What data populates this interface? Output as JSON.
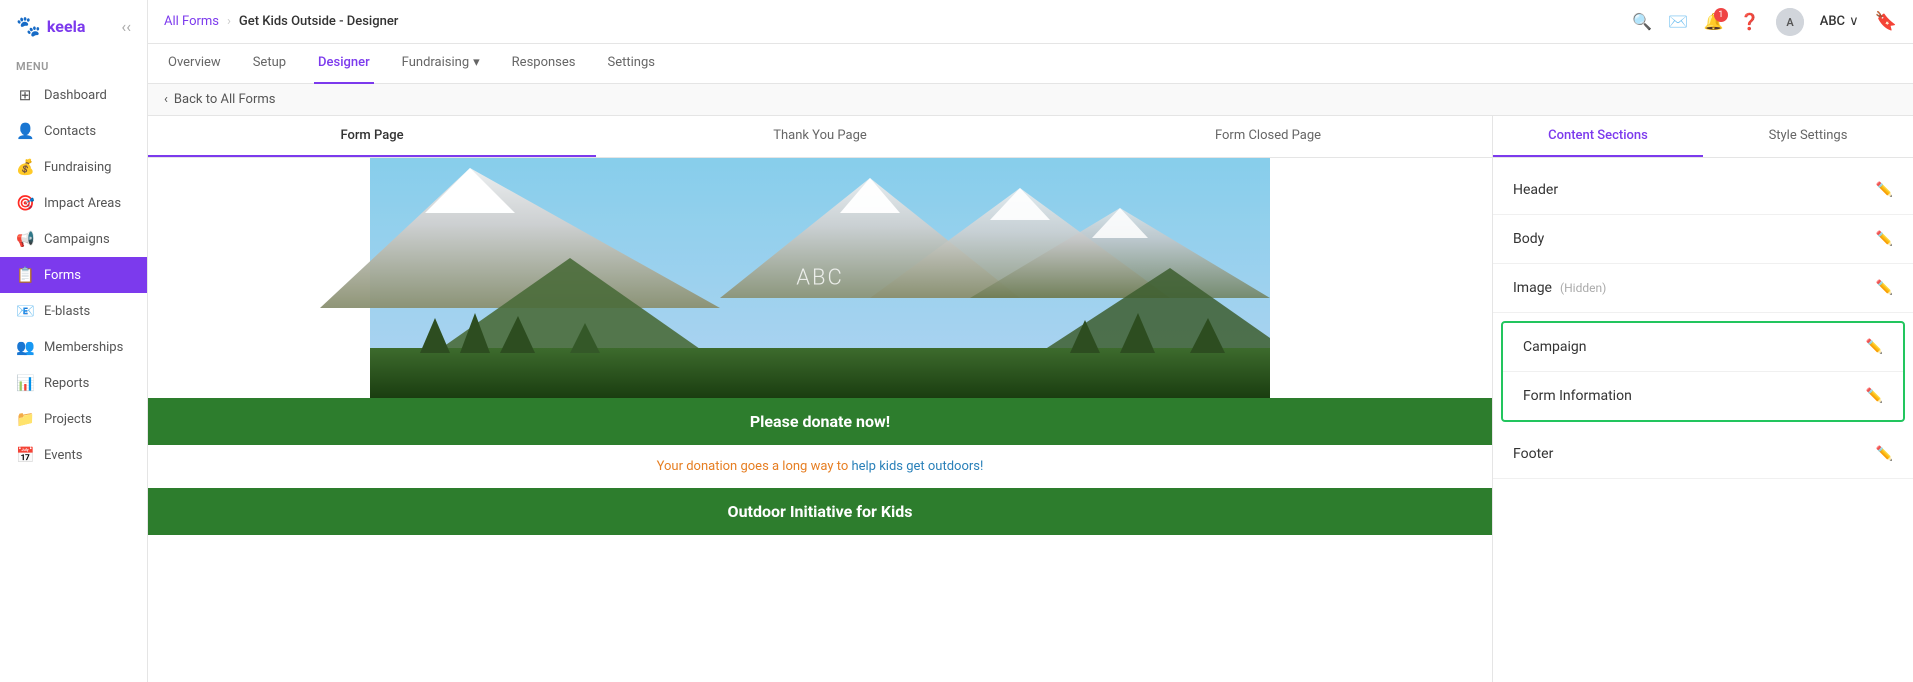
{
  "logo": {
    "icon": "🐾",
    "text": "keela"
  },
  "sidebar": {
    "menu_label": "MENU",
    "items": [
      {
        "id": "dashboard",
        "label": "Dashboard",
        "icon": "⊞"
      },
      {
        "id": "contacts",
        "label": "Contacts",
        "icon": "👤"
      },
      {
        "id": "fundraising",
        "label": "Fundraising",
        "icon": "💰"
      },
      {
        "id": "impact-areas",
        "label": "Impact Areas",
        "icon": "🎯"
      },
      {
        "id": "campaigns",
        "label": "Campaigns",
        "icon": "📢"
      },
      {
        "id": "forms",
        "label": "Forms",
        "icon": "📋",
        "active": true
      },
      {
        "id": "e-blasts",
        "label": "E-blasts",
        "icon": "📧"
      },
      {
        "id": "memberships",
        "label": "Memberships",
        "icon": "👥"
      },
      {
        "id": "reports",
        "label": "Reports",
        "icon": "📊"
      },
      {
        "id": "projects",
        "label": "Projects",
        "icon": "📁"
      },
      {
        "id": "events",
        "label": "Events",
        "icon": "📅"
      }
    ]
  },
  "topbar": {
    "breadcrumb_link": "All Forms",
    "breadcrumb_sep": "›",
    "breadcrumb_current": "Get Kids Outside - Designer",
    "user_name": "ABC",
    "user_chevron": "∨"
  },
  "subnav": {
    "tabs": [
      {
        "id": "overview",
        "label": "Overview",
        "active": false
      },
      {
        "id": "setup",
        "label": "Setup",
        "active": false
      },
      {
        "id": "designer",
        "label": "Designer",
        "active": true
      },
      {
        "id": "fundraising",
        "label": "Fundraising",
        "active": false,
        "has_arrow": true
      },
      {
        "id": "responses",
        "label": "Responses",
        "active": false
      },
      {
        "id": "settings",
        "label": "Settings",
        "active": false
      }
    ]
  },
  "backbar": {
    "back_label": "‹ Back to All Forms"
  },
  "preview_tabs": [
    {
      "id": "form-page",
      "label": "Form Page",
      "active": true
    },
    {
      "id": "thank-you",
      "label": "Thank You Page",
      "active": false
    },
    {
      "id": "form-closed",
      "label": "Form Closed Page",
      "active": false
    }
  ],
  "form": {
    "hero_text": "ABC",
    "cta_text": "Please donate now!",
    "subtitle_part1": "Your donation goes a long way to ",
    "subtitle_link": "help kids get outdoors!",
    "initiative_text": "Outdoor Initiative for Kids"
  },
  "right_panel": {
    "tabs": [
      {
        "id": "content-sections",
        "label": "Content Sections",
        "active": true
      },
      {
        "id": "style-settings",
        "label": "Style Settings",
        "active": false
      }
    ],
    "sections": [
      {
        "id": "header",
        "label": "Header",
        "hidden": false,
        "highlighted": false
      },
      {
        "id": "body",
        "label": "Body",
        "hidden": false,
        "highlighted": false
      },
      {
        "id": "image",
        "label": "Image",
        "hidden": true,
        "hidden_label": "(Hidden)",
        "highlighted": false
      },
      {
        "id": "campaign",
        "label": "Campaign",
        "hidden": false,
        "highlighted": true
      },
      {
        "id": "form-information",
        "label": "Form Information",
        "hidden": false,
        "highlighted": true
      },
      {
        "id": "footer",
        "label": "Footer",
        "hidden": false,
        "highlighted": false
      }
    ]
  },
  "colors": {
    "accent": "#7c3aed",
    "green": "#22c55e",
    "form_green": "#2d7d2d"
  }
}
